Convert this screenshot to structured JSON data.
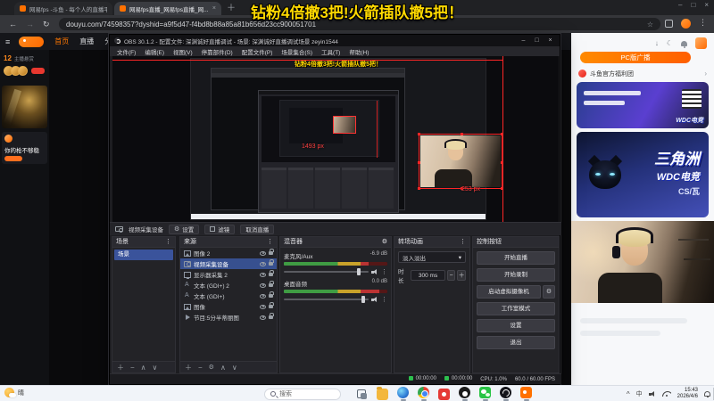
{
  "colors": {
    "banner_yellow": "#ffd900",
    "douyu_orange": "#ff7100",
    "selection_red": "#ff2626",
    "obs_selection_blue": "#37508f",
    "brand_blue": "#2a3f8f",
    "meter_green": "#3f9c43",
    "taskbar_bg": "#f1f4f9"
  },
  "icons": [
    "hamburger-icon",
    "back-icon",
    "forward-icon",
    "refresh-icon",
    "star-icon",
    "extensions-icon",
    "menu-dots-icon",
    "close-icon",
    "minimize-icon",
    "maximize-icon",
    "search-icon",
    "gear-icon",
    "eye-icon",
    "lock-icon",
    "plus-icon",
    "minus-icon",
    "up-icon",
    "down-icon",
    "caret-down-icon",
    "speaker-icon",
    "camera-icon",
    "filter-icon",
    "moon-icon",
    "bell-icon",
    "download-icon",
    "chevron-right-icon",
    "weather-sun-icon",
    "task-view-icon",
    "folder-icon",
    "edge-icon",
    "chrome-icon",
    "qq-icon",
    "wechat-icon",
    "obs-icon",
    "douyu-icon",
    "wifi-icon",
    "volume-icon",
    "ime-indicator"
  ],
  "banner": {
    "text": "钻粉4倍撤3把!火箭插队撤5把！"
  },
  "browser": {
    "tabs": [
      {
        "title": "网易fps -斗鱼 - 每个人的直播平台"
      },
      {
        "title": "网易fps直播_网易fps直播_网..."
      }
    ],
    "url": "douyu.com/74598357?dyshid=a9f5d47-f4bd8b88a85a81b656d23cc900051701"
  },
  "douyu": {
    "nav": {
      "home": "首页",
      "live": "直播",
      "category": "分类"
    },
    "left_rail": {
      "rank_number": "12",
      "rank_label": "主播悬赏",
      "card_title": "你的枪不够稳"
    },
    "sidebar": {
      "pc_button": "PC版广播",
      "welfare_title": "斗鱼官方福利团",
      "brand_title": "三角洲",
      "brand_sub": "WDC电竞",
      "brand_game": "CS/瓦"
    }
  },
  "obs": {
    "title": "OBS 30.1.2 - 配置文件: 深渊诚好直播调试 - 场景: 深渊诚好直播调试场景  zeyin1544",
    "menu": [
      "文件(F)",
      "编辑(E)",
      "视图(V)",
      "停靠部件(D)",
      "配置文件(P)",
      "场景集合(S)",
      "工具(T)",
      "帮助(H)"
    ],
    "preview": {
      "measure_width": "1493 px",
      "measure_height": "253 px"
    },
    "source_toolbar": {
      "source_label": "视频采集设备",
      "buttons": [
        "设置",
        "滤镜",
        "取消直播"
      ]
    },
    "panels": {
      "scenes": {
        "title": "场景",
        "items": [
          "场景"
        ]
      },
      "sources": {
        "title": "来源",
        "items": [
          {
            "label": "图像 2"
          },
          {
            "label": "视频采集设备"
          },
          {
            "label": "显示器采集 2"
          },
          {
            "label": "文本 (GDI+) 2"
          },
          {
            "label": "文本 (GDI+)"
          },
          {
            "label": "图像"
          },
          {
            "label": "节目:5分半蒂丽图"
          }
        ]
      },
      "mixer": {
        "title": "混音器",
        "channels": [
          {
            "name": "麦克风/Aux",
            "db": "-6.9 dB"
          },
          {
            "name": "桌面音频",
            "db": "0.0 dB"
          }
        ]
      },
      "transitions": {
        "title": "转场动画",
        "selected": "淡入淡出",
        "duration_label": "时长",
        "duration": "300 ms"
      },
      "controls": {
        "title": "控制按钮",
        "buttons": [
          "开始直播",
          "开始录制",
          "启动虚拟摄像机",
          "工作室模式",
          "设置",
          "退出"
        ]
      }
    },
    "status": {
      "live_time": "00:00:00",
      "rec_time": "00:00:00",
      "cpu": "CPU: 1.0%",
      "fps": "60.0 / 60.00 FPS"
    }
  },
  "taskbar": {
    "weather": "晴",
    "search_label": "搜索",
    "ime": "中",
    "time": "15:43",
    "date": "2026/4/6"
  }
}
